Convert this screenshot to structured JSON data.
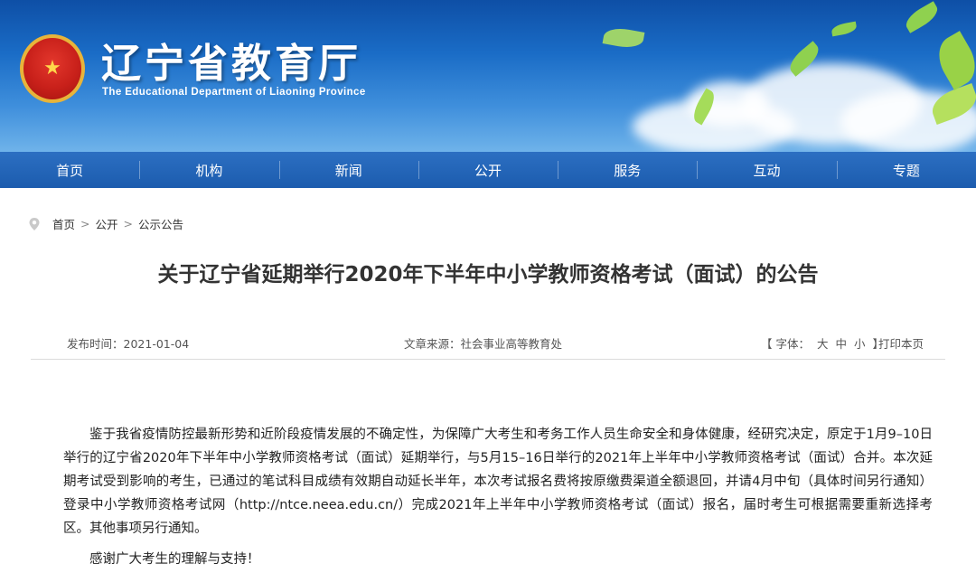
{
  "header": {
    "title": "辽宁省教育厅",
    "subtitle": "The Educational Department of Liaoning Province",
    "emblem_icon": "national-emblem-icon"
  },
  "nav": {
    "items": [
      "首页",
      "机构",
      "新闻",
      "公开",
      "服务",
      "互动",
      "专题"
    ]
  },
  "breadcrumb": {
    "items": [
      "首页",
      "公开",
      "公示公告"
    ],
    "separator": ">"
  },
  "article": {
    "title": "关于辽宁省延期举行2020年下半年中小学教师资格考试（面试）的公告",
    "publish_label": "发布时间：",
    "publish_date": "2021-01-04",
    "source_label": "文章来源：",
    "source": "社会事业高等教育处",
    "font_label": "【 字体：",
    "font_large": "大",
    "font_medium": "中",
    "font_small": "小",
    "font_close": "】",
    "print_label": "打印本页",
    "paragraphs": [
      "鉴于我省疫情防控最新形势和近阶段疫情发展的不确定性，为保障广大考生和考务工作人员生命安全和身体健康，经研究决定，原定于1月9–10日举行的辽宁省2020年下半年中小学教师资格考试（面试）延期举行，与5月15–16日举行的2021年上半年中小学教师资格考试（面试）合并。本次延期考试受到影响的考生，已通过的笔试科目成绩有效期自动延长半年，本次考试报名费将按原缴费渠道全额退回，并请4月中旬（具体时间另行通知）登录中小学教师资格考试网（http://ntce.neea.edu.cn/）完成2021年上半年中小学教师资格考试（面试）报名，届时考生可根据需要重新选择考区。其他事项另行通知。",
      "感谢广大考生的理解与支持！"
    ]
  },
  "colors": {
    "nav_bg": "#1c5cae",
    "banner_top": "#0e4fa6",
    "banner_bottom": "#6fb3ea"
  }
}
